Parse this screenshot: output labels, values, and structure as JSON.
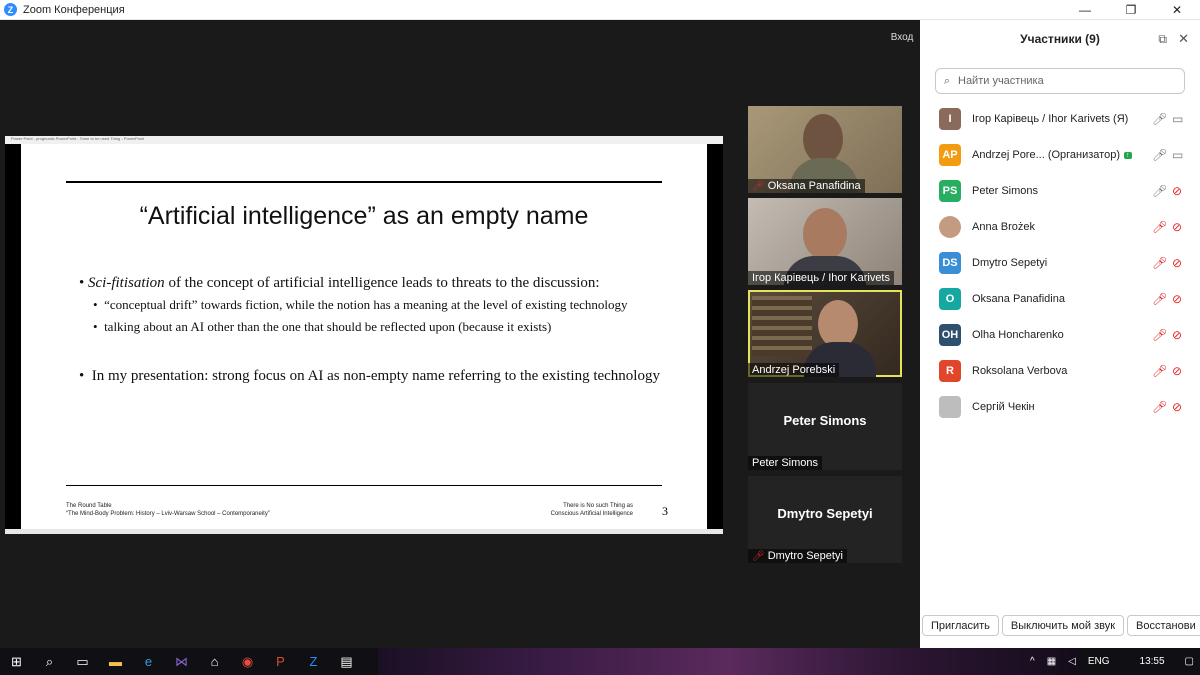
{
  "window": {
    "title": "Zoom Конференция",
    "minimize_icon": "—",
    "maximize_icon": "❐",
    "close_icon": "✕"
  },
  "stage": {
    "exit_label": "Вход"
  },
  "slide": {
    "window_caption": "Power Point - prognostic.PowerPoint - Tome to be used Thing - PowerPoint",
    "title": "“Artificial intelligence” as an empty name",
    "bullets": [
      {
        "emph": "Sci-fitisation",
        "rest": " of the concept of artificial intelligence leads to threats to the discussion:"
      },
      {
        "text": "“conceptual drift” towards fiction, while the notion has a meaning at the level of existing technology"
      },
      {
        "text": "talking about an AI other than the one that should be reflected upon (because it exists)"
      },
      {
        "text": "In my presentation: strong focus on AI as non-empty name referring to the existing technology"
      }
    ],
    "footer_left_1": "The Round Table",
    "footer_left_2": "“The Mind-Body Problem: History – Lviv-Warsaw School – Contemporaneity”",
    "footer_right_1": "There is No such Thing as",
    "footer_right_2": "Conscious Artificial Intelligence",
    "page_number": "3"
  },
  "video_tiles": [
    {
      "name": "Oksana Panafidina",
      "muted": true
    },
    {
      "name": "Ігор Карівець / Ihor Karivets",
      "muted": false
    },
    {
      "name": "Andrzej Porebski",
      "muted": false,
      "active": true
    },
    {
      "name": "Peter Simons",
      "center_label": "Peter Simons",
      "muted": false
    },
    {
      "name": "Dmytro Sepetyi",
      "center_label": "Dmytro Sepetyi",
      "muted": true
    }
  ],
  "participants_panel": {
    "title": "Участники (9)",
    "search_placeholder": "Найти участника",
    "participants": [
      {
        "initials": "I",
        "color": "#8a6a5a",
        "name": "Ігор Карівець / Ihor Karivets (Я)",
        "mic_muted": false,
        "cam_off": false
      },
      {
        "initials": "AP",
        "color": "#f39c12",
        "name": "Andrzej Pore... (Организатор)",
        "badge": "↑",
        "mic_muted": false,
        "cam_off": false
      },
      {
        "initials": "PS",
        "color": "#27ae60",
        "name": "Peter Simons",
        "mic_muted": false,
        "cam_off": true
      },
      {
        "initials": "",
        "color": "#c49a80",
        "name": "Anna Brożek",
        "photo": true,
        "mic_muted": true,
        "cam_off": true
      },
      {
        "initials": "DS",
        "color": "#3a8ed6",
        "name": "Dmytro Sepetyi",
        "mic_muted": true,
        "cam_off": true
      },
      {
        "initials": "O",
        "color": "#16a7a0",
        "name": "Oksana Panafidina",
        "mic_muted": true,
        "cam_off": true
      },
      {
        "initials": "OH",
        "color": "#2f4f6f",
        "name": "Olha Honcharenko",
        "mic_muted": true,
        "cam_off": true
      },
      {
        "initials": "R",
        "color": "#e2452a",
        "name": "Roksolana Verbova",
        "mic_muted": true,
        "cam_off": true
      },
      {
        "initials": "",
        "color": "#bdbdbd",
        "name": "Сергій Чекін",
        "photo": true,
        "mic_muted": true,
        "cam_off": true
      }
    ],
    "buttons": {
      "invite": "Пригласить",
      "mute_me": "Выключить мой звук",
      "restore": "Восстанови"
    }
  },
  "taskbar": {
    "language": "ENG",
    "time": "13:55"
  }
}
